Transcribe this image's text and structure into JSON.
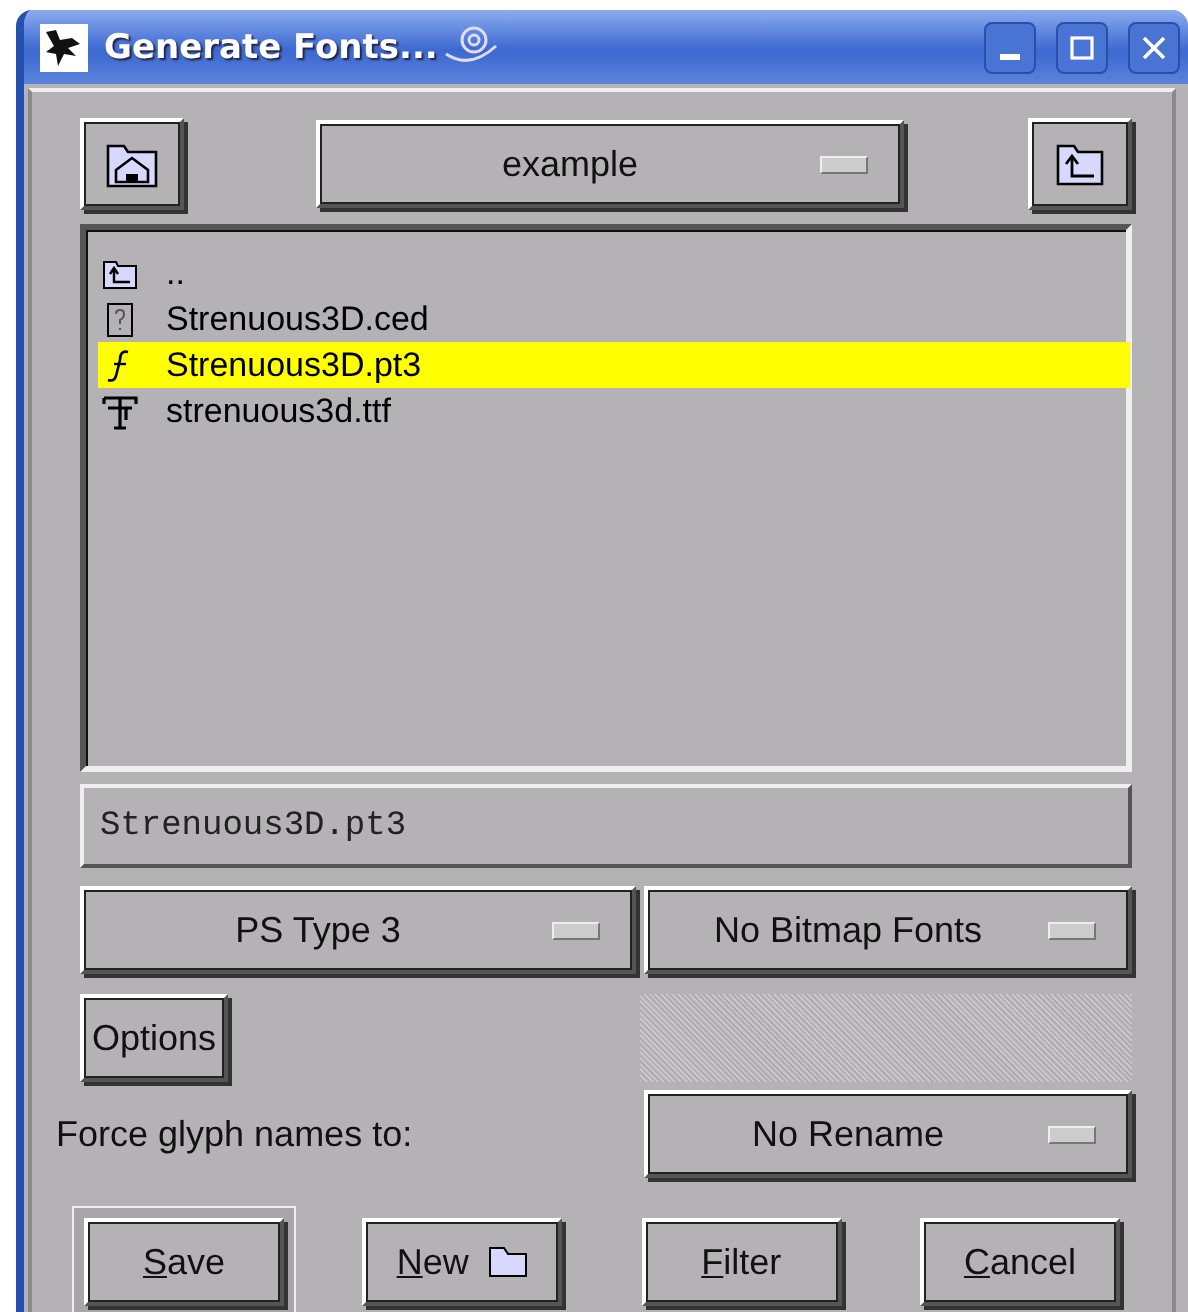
{
  "window": {
    "title": "Generate Fonts..."
  },
  "directory": {
    "value": "example"
  },
  "files": [
    {
      "name": "..",
      "kind": "parent",
      "selected": false
    },
    {
      "name": "Strenuous3D.ced",
      "kind": "unknown",
      "selected": false
    },
    {
      "name": "Strenuous3D.pt3",
      "kind": "type3",
      "selected": true
    },
    {
      "name": "strenuous3d.ttf",
      "kind": "truetype",
      "selected": false
    }
  ],
  "filename": {
    "value": "Strenuous3D.pt3"
  },
  "format_dropdown": {
    "value": "PS Type 3"
  },
  "bitmap_dropdown": {
    "value": "No Bitmap Fonts"
  },
  "options_button": {
    "label": "Options"
  },
  "bitmap_options": {
    "disabled": true
  },
  "rename": {
    "label": "Force glyph names to:",
    "value": "No Rename"
  },
  "buttons": [
    {
      "label": "Save",
      "kind": "text",
      "default": true,
      "underline_first": true
    },
    {
      "label": "New",
      "kind": "folder",
      "default": false,
      "underline_first": true
    },
    {
      "label": "Filter",
      "kind": "text",
      "default": false,
      "underline_first": true
    },
    {
      "label": "Cancel",
      "kind": "text",
      "default": false,
      "underline_first": true
    }
  ]
}
